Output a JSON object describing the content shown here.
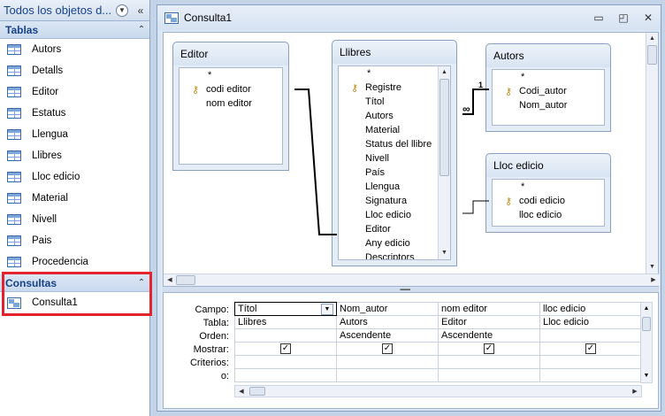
{
  "nav": {
    "title": "Todos los objetos d...",
    "tables_header": "Tablas",
    "tables": [
      "Autors",
      "Detalls",
      "Editor",
      "Estatus",
      "Llengua",
      "Llibres",
      "Lloc edicio",
      "Material",
      "Nivell",
      "Pais",
      "Procedencia"
    ],
    "queries_header": "Consultas",
    "queries": [
      "Consulta1"
    ]
  },
  "window": {
    "title": "Consulta1",
    "minimize": "▭",
    "restore": "◰",
    "close": "✕"
  },
  "field_lists": {
    "editor": {
      "title": "Editor",
      "fields": [
        {
          "name": "*",
          "key": false
        },
        {
          "name": "codi editor",
          "key": true
        },
        {
          "name": "nom editor",
          "key": false
        }
      ]
    },
    "llibres": {
      "title": "Llibres",
      "fields": [
        {
          "name": "*",
          "key": false
        },
        {
          "name": "Registre",
          "key": true
        },
        {
          "name": "Títol",
          "key": false
        },
        {
          "name": "Autors",
          "key": false
        },
        {
          "name": "Material",
          "key": false
        },
        {
          "name": "Status del llibre",
          "key": false
        },
        {
          "name": "Nivell",
          "key": false
        },
        {
          "name": "País",
          "key": false
        },
        {
          "name": "Llengua",
          "key": false
        },
        {
          "name": "Signatura",
          "key": false
        },
        {
          "name": "Lloc edicio",
          "key": false
        },
        {
          "name": "Editor",
          "key": false
        },
        {
          "name": "Any edicio",
          "key": false
        },
        {
          "name": "Descriptors",
          "key": false
        }
      ]
    },
    "autors": {
      "title": "Autors",
      "fields": [
        {
          "name": "*",
          "key": false
        },
        {
          "name": "Codi_autor",
          "key": true
        },
        {
          "name": "Nom_autor",
          "key": false
        }
      ]
    },
    "lloc": {
      "title": "Lloc edicio",
      "fields": [
        {
          "name": "*",
          "key": false
        },
        {
          "name": "codi edicio",
          "key": true
        },
        {
          "name": "lloc edicio",
          "key": false
        }
      ]
    }
  },
  "relationship_labels": {
    "one": "1",
    "many": "∞"
  },
  "grid": {
    "row_labels": [
      "Campo:",
      "Tabla:",
      "Orden:",
      "Mostrar:",
      "Criterios:",
      "o:"
    ],
    "columns": [
      {
        "campo": "Títol",
        "tabla": "Llibres",
        "orden": "",
        "mostrar": true
      },
      {
        "campo": "Nom_autor",
        "tabla": "Autors",
        "orden": "Ascendente",
        "mostrar": true
      },
      {
        "campo": "nom editor",
        "tabla": "Editor",
        "orden": "Ascendente",
        "mostrar": true
      },
      {
        "campo": "lloc edicio",
        "tabla": "Lloc edicio",
        "orden": "",
        "mostrar": true
      }
    ]
  }
}
